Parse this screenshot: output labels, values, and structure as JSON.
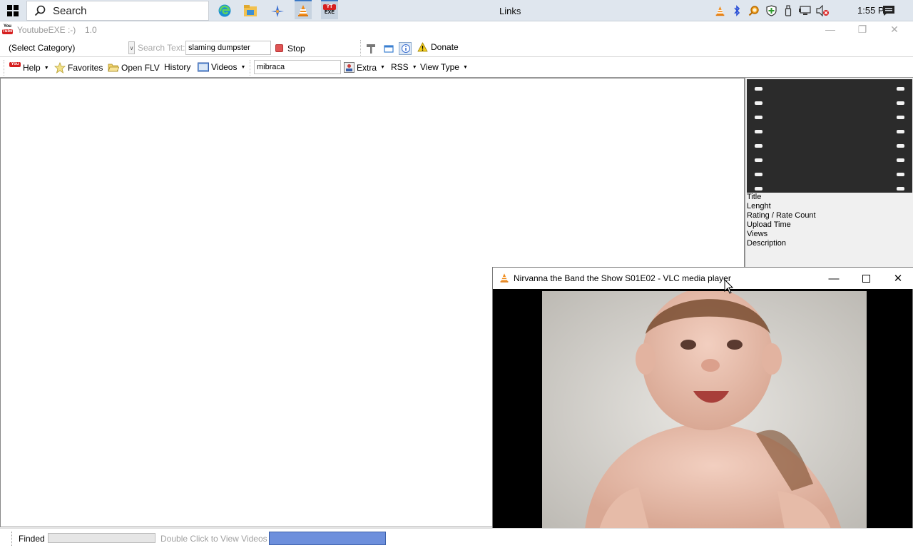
{
  "taskbar": {
    "search_label": "Search",
    "center_title": "Links",
    "clock": "1:55 PM",
    "apps": [
      {
        "icon": "edge-icon"
      },
      {
        "icon": "file-explorer-icon"
      },
      {
        "icon": "feather-app-icon"
      },
      {
        "icon": "vlc-icon"
      },
      {
        "icon": "youtube-exe-icon",
        "text": "EXE"
      }
    ],
    "tray_icons": [
      "vlc-tray-icon",
      "bluetooth-icon",
      "search-magnifier-tray-icon",
      "shield-icon",
      "usb-icon",
      "network-icon",
      "volume-muted-icon"
    ]
  },
  "app": {
    "title": "YoutubeEXE  :-)",
    "version": "1.0",
    "logo_top": "You",
    "logo_bottom": "Tube"
  },
  "toolbar1": {
    "category": "(Select Category)",
    "search_text_label": "Search Text:",
    "search_text_value": "slaming dumpster",
    "stop_label": "Stop",
    "donate_label": "Donate"
  },
  "toolbar2": {
    "help": "Help",
    "favorites": "Favorites",
    "open_flv": "Open FLV",
    "history": "History",
    "videos": "Videos",
    "query": "mibraca",
    "extra": "Extra",
    "rss": "RSS",
    "view_type": "View Type"
  },
  "side_panel": {
    "fields": [
      "Title",
      "Lenght",
      "Rating / Rate Count",
      "Upload Time",
      "Views",
      "Description"
    ]
  },
  "vlc": {
    "title": "Nirvanna the Band the Show S01E02 - VLC media player"
  },
  "status": {
    "text": "Finded",
    "hint": "Double Click to View Videos"
  },
  "colors": {
    "taskbar_bg": "#dfe6ee",
    "progress_fill": "#6d8fdc",
    "stop_red": "#e05555"
  }
}
